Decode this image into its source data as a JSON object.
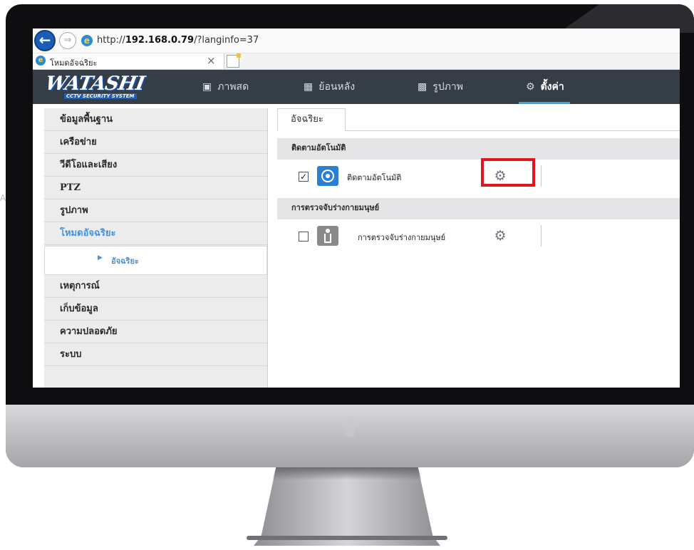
{
  "browser": {
    "url_prefix": "http://",
    "url_host": "192.168.0.79",
    "url_path": "/?langinfo=37",
    "tab_title": "โหมดอัจฉริยะ",
    "back_icon": "back-arrow-icon",
    "forward_icon": "forward-arrow-icon"
  },
  "brand": {
    "logo_text": "ATASHI",
    "logo_w": "W",
    "logo_subtitle": "CCTV SECURITY SYSTEM"
  },
  "nav": {
    "live": "ภาพสด",
    "playback": "ย้อนหลัง",
    "picture": "รูปภาพ",
    "settings": "ตั้งค่า"
  },
  "sidebar": {
    "items": [
      {
        "label": "ข้อมูลพื้นฐาน"
      },
      {
        "label": "เครือข่าย"
      },
      {
        "label": "วีดีโอและเสียง"
      },
      {
        "label": "PTZ"
      },
      {
        "label": "รูปภาพ"
      },
      {
        "label": "โหมดอัจฉริยะ"
      },
      {
        "label": "เหตุการณ์"
      },
      {
        "label": "เก็บข้อมูล"
      },
      {
        "label": "ความปลอดภัย"
      },
      {
        "label": "ระบบ"
      }
    ],
    "active_index": 5,
    "sub_item": "อัจฉริยะ"
  },
  "content": {
    "tab": "อัจฉริยะ",
    "sections": [
      {
        "title": "ติดตามอัตโนมัติ",
        "feature_label": "ติดตามอัตโนมัติ",
        "checked": true
      },
      {
        "title": "การตรวจจับร่างกายมนุษย์",
        "feature_label": "การตรวจจับร่างกายมนุษย์",
        "checked": false
      }
    ]
  },
  "colors": {
    "header_bg": "#353d47",
    "accent_blue": "#4a93d6",
    "highlight_red": "#e3141c"
  },
  "stray_text": "A"
}
